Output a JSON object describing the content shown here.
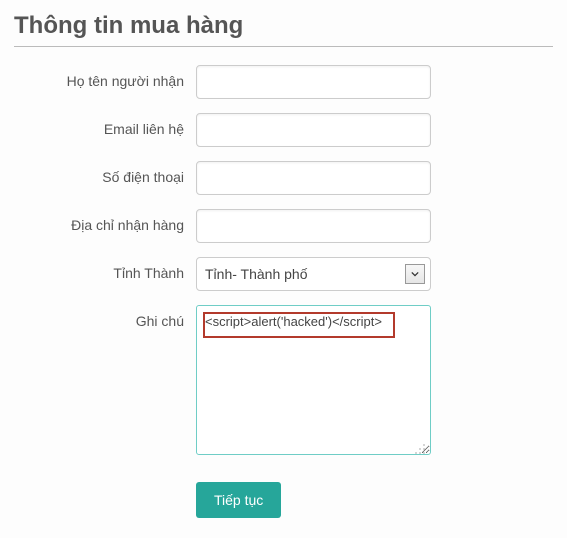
{
  "title": "Thông tin mua hàng",
  "labels": {
    "recipient_name": "Họ tên người nhận",
    "email": "Email liên hệ",
    "phone": "Số điện thoại",
    "address": "Địa chỉ nhận hàng",
    "province": "Tỉnh Thành",
    "note": "Ghi chú"
  },
  "fields": {
    "recipient_name": "",
    "email": "",
    "phone": "",
    "address": "",
    "province_selected": "Tỉnh- Thành phố",
    "note": "<script>alert('hacked')</script>"
  },
  "buttons": {
    "continue": "Tiếp tục"
  }
}
